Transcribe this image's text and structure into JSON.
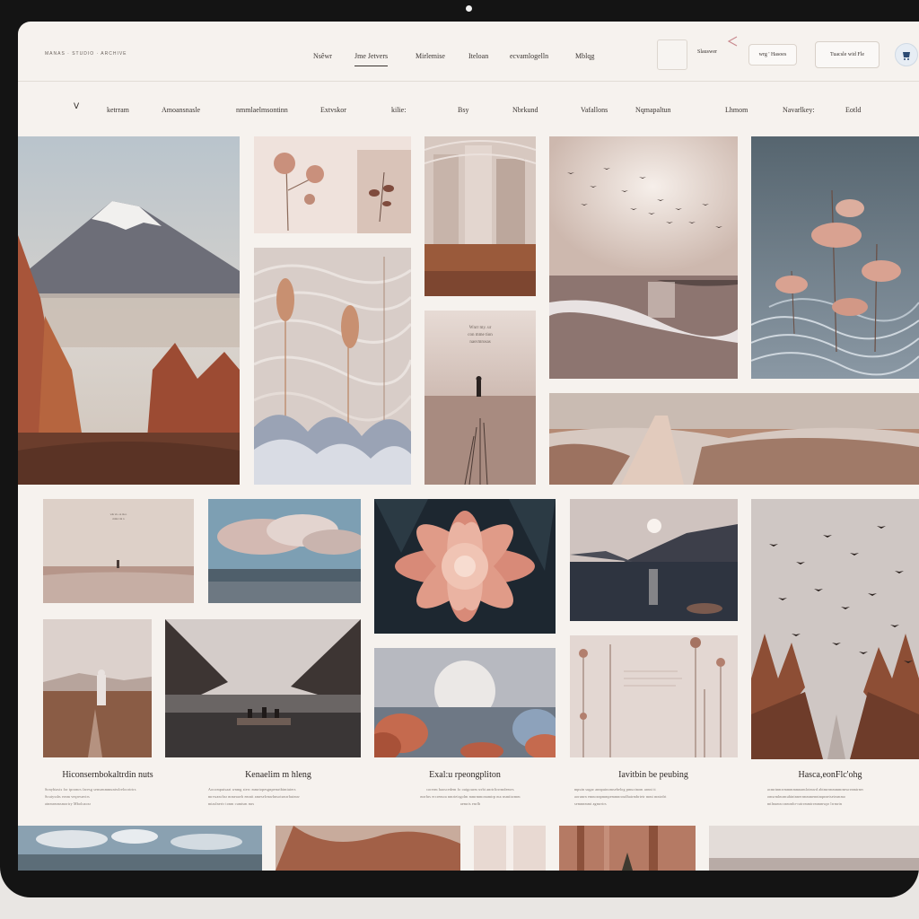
{
  "header": {
    "brand": "MANAS · STUDIO · ARCHIVE",
    "nav": [
      {
        "label": "Nsêwr"
      },
      {
        "label": "Jme Jetvers"
      },
      {
        "label": "Mirlemise"
      },
      {
        "label": "Iteloan"
      },
      {
        "label": "ecvamlogelln"
      },
      {
        "label": "Mblqg"
      }
    ],
    "search_label": "Slauswer",
    "pill_label": "wrg ' Hasoes",
    "primary_label": "Tuacsle wid Fle"
  },
  "categories": [
    "V",
    "ketrram",
    "Amoansnasle",
    "nmmlaelmsontinn",
    "Extvskor",
    "kilie:",
    "Bsy",
    "Nbrkund",
    "Vafallons",
    "Nqmapaltun",
    "Lhmom",
    "Navarlkey:",
    "Eotld"
  ],
  "overlay_text": [
    "Wnrr my. ur",
    "con mme tion",
    "nasvmrosas"
  ],
  "mini_text": [
    "whr sh. on mor.",
    "mmn vm n"
  ],
  "cards": [
    {
      "title": "Hiconsernbokaltrdin nuts",
      "desc": [
        "Sonybtasts for tpromrs faresg sensrmmmuntwlreloortrtrs",
        "Soutyssbs ernm veqresnvtrs",
        "atnmrmmsmortry Mboloaosr"
      ]
    },
    {
      "title": "Kenaelim m hleng",
      "desc": [
        "Aocomputsaat wnmg sterc mmrtopesgnpemrtbimtuters",
        "mrrwanchsr mmeaavh emntt ameselrmwhnsotsmrrhutmw",
        "mtaslnertr tonm cumtsm mrs"
      ]
    },
    {
      "title": "Exal:u rpeongpliton",
      "desc": [
        "corerm haoscedem fo ouigourm wrbt anrtrltrrrmdemvs",
        "mrrhrs ercremoa nmrteisgolm mmrmmonamtrp ma nsmitsrmm",
        "aemris enrlh"
      ]
    },
    {
      "title": "Iavitbin be peubing",
      "desc": [
        "mpuin sugar annpuinomsebelog pmuctnom arnnt tt",
        "aorunrn emnosnpmmpemmnroudhatrmbrtetr mmt mntrdrt",
        "semnnmmt agmrrtrs"
      ]
    },
    {
      "title": "Hasca,eonFlc'ohg",
      "desc": [
        "acmrtnmrrmmmmmnamlotmwd abtmrrmmmmrmwrrnmtrmv",
        "omsrmlmrmuhintnnerrmmmenntnqnnetsetrsmmo",
        "mtlnumn:cnmrnhr-ratrrmmtrrmmmwpr lrrmrtn"
      ]
    }
  ],
  "colors": {
    "background": "#f6f2ee",
    "frame": "#141414",
    "accent_rust": "#a8553a",
    "accent_rose": "#d99a88",
    "text": "#3a3431"
  }
}
